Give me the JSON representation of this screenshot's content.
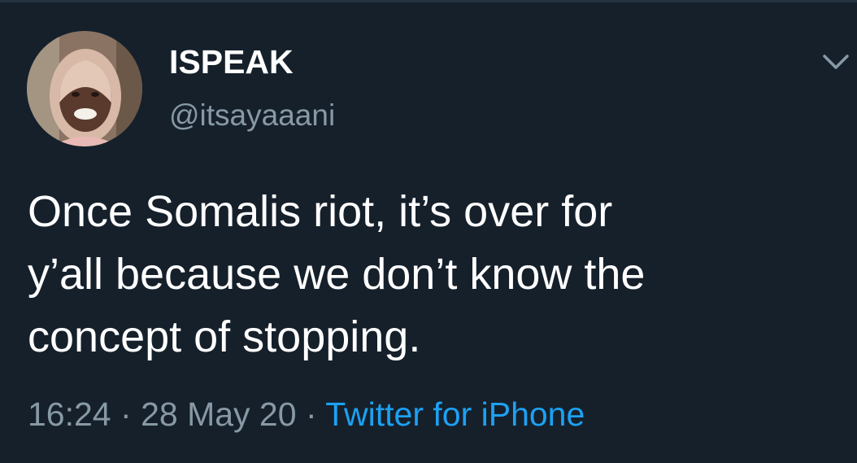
{
  "tweet": {
    "author": {
      "display_name": "ISPEAK",
      "handle": "@itsayaaani",
      "avatar_icon": "profile-photo"
    },
    "menu_icon": "chevron-down-icon",
    "text": "Once Somalis riot, it’s over for\ny’all because we don’t know the\nconcept of stopping.",
    "time": "16:24",
    "separator": "·",
    "date": "28 May 20",
    "source": "Twitter for iPhone"
  },
  "colors": {
    "background": "#15202b",
    "primary_text": "#ffffff",
    "secondary_text": "#8899a6",
    "link": "#1da1f2"
  }
}
